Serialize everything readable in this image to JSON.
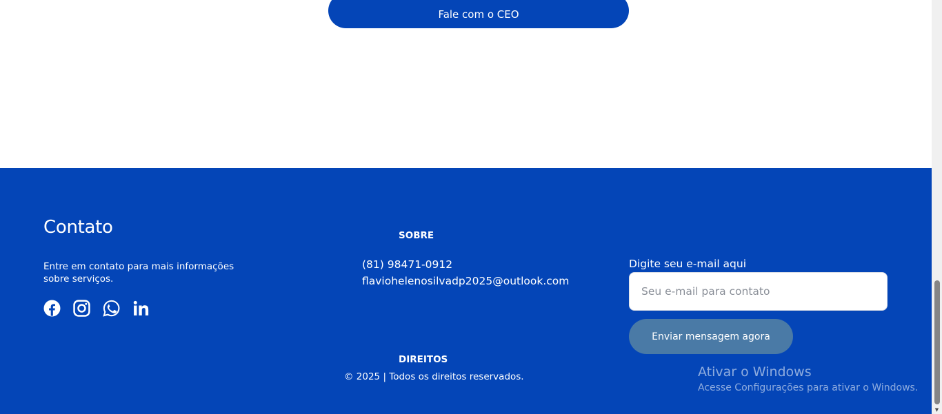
{
  "top": {
    "ceo_button_label": "Fale com o CEO"
  },
  "footer": {
    "contact": {
      "title": "Contato",
      "description": "Entre em contato para mais informações sobre serviços."
    },
    "socials": [
      {
        "icon": "facebook-icon"
      },
      {
        "icon": "instagram-icon"
      },
      {
        "icon": "whatsapp-icon"
      },
      {
        "icon": "linkedin-icon"
      }
    ],
    "sobre": {
      "title": "SOBRE",
      "phone": "(81) 98471-0912",
      "email": "flaviohelenosilvadp2025@outlook.com"
    },
    "direitos": {
      "title": "DIREITOS",
      "copyright": "© 2025 | Todos os direitos reservados."
    },
    "newsletter": {
      "label": "Digite seu e-mail aqui",
      "placeholder": "Seu e-mail para contato",
      "value": "",
      "button_label": "Enviar mensagem agora"
    }
  },
  "watermark": {
    "title": "Ativar o Windows",
    "subtitle": "Acesse Configurações para ativar o Windows."
  },
  "colors": {
    "brand_blue": "#0445b7",
    "send_button": "#4a7aa6",
    "white": "#ffffff"
  }
}
